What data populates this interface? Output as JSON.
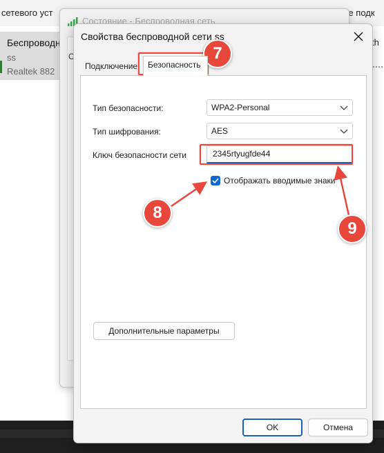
{
  "background": {
    "top_left_text": "сетевого уст",
    "top_right_text": "ние подк",
    "item_title": "Беспроводн",
    "item_sub1": "ss",
    "item_sub2": "Realtek 882",
    "right_partial": "th"
  },
  "status_window": {
    "title": "Состояние - Беспроводная сеть",
    "partial_tab": "С"
  },
  "dialog": {
    "title": "Свойства беспроводной сети ss",
    "close_icon": "close-icon",
    "tabs": [
      {
        "label": "Подключение",
        "active": false
      },
      {
        "label": "Безопасность",
        "active": true
      }
    ],
    "security_type": {
      "label": "Тип безопасности:",
      "value": "WPA2-Personal"
    },
    "encryption_type": {
      "label": "Тип шифрования:",
      "value": "AES"
    },
    "network_key": {
      "label": "Ключ безопасности сети",
      "value": "2345rtyugfde44"
    },
    "show_chars": {
      "label": "Отображать вводимые знаки",
      "checked": true
    },
    "advanced_button": "Дополнительные параметры",
    "ok_button": "OK",
    "cancel_button": "Отмена"
  },
  "annotations": {
    "callout_7": "7",
    "callout_8": "8",
    "callout_9": "9",
    "color": "#e8473c"
  },
  "colors": {
    "accent": "#1266d0",
    "checkbox_blue": "#1266d0"
  }
}
